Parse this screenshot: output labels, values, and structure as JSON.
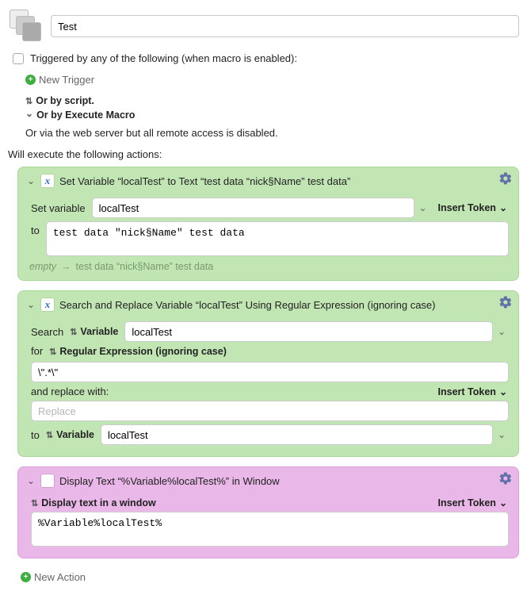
{
  "macro": {
    "name": "Test",
    "triggered_by_label": "Triggered by any of the following (when macro is enabled):",
    "new_trigger": "New Trigger",
    "or_script": "Or by script.",
    "or_exec_macro": "Or by Execute Macro",
    "or_web": "Or via the web server but all remote access is disabled.",
    "will_execute": "Will execute the following actions:",
    "new_action": "New Action"
  },
  "tokens": {
    "insert": "Insert Token"
  },
  "action1": {
    "title": "Set Variable “localTest” to Text “test data “nick§Name” test data”",
    "set_variable_label": "Set variable",
    "variable_name": "localTest",
    "to_label": "to",
    "text_value": "test data \"nick§Name\" test data",
    "preview_lhs": "empty",
    "preview_rhs": "test data “nick§Name” test data"
  },
  "action2": {
    "title": "Search and Replace Variable “localTest” Using Regular Expression (ignoring case)",
    "search_label": "Search",
    "variable_mode": "Variable",
    "variable_name": "localTest",
    "for_label": "for",
    "for_mode": "Regular Expression (ignoring case)",
    "pattern": "\\\".*\\\"",
    "replace_label": "and replace with:",
    "replace_placeholder": "Replace",
    "replace_value": "",
    "to_label": "to",
    "to_mode": "Variable",
    "to_variable": "localTest"
  },
  "action3": {
    "title": "Display Text “%Variable%localTest%” in Window",
    "mode_label": "Display text in a window",
    "text_value": "%Variable%localTest%"
  }
}
